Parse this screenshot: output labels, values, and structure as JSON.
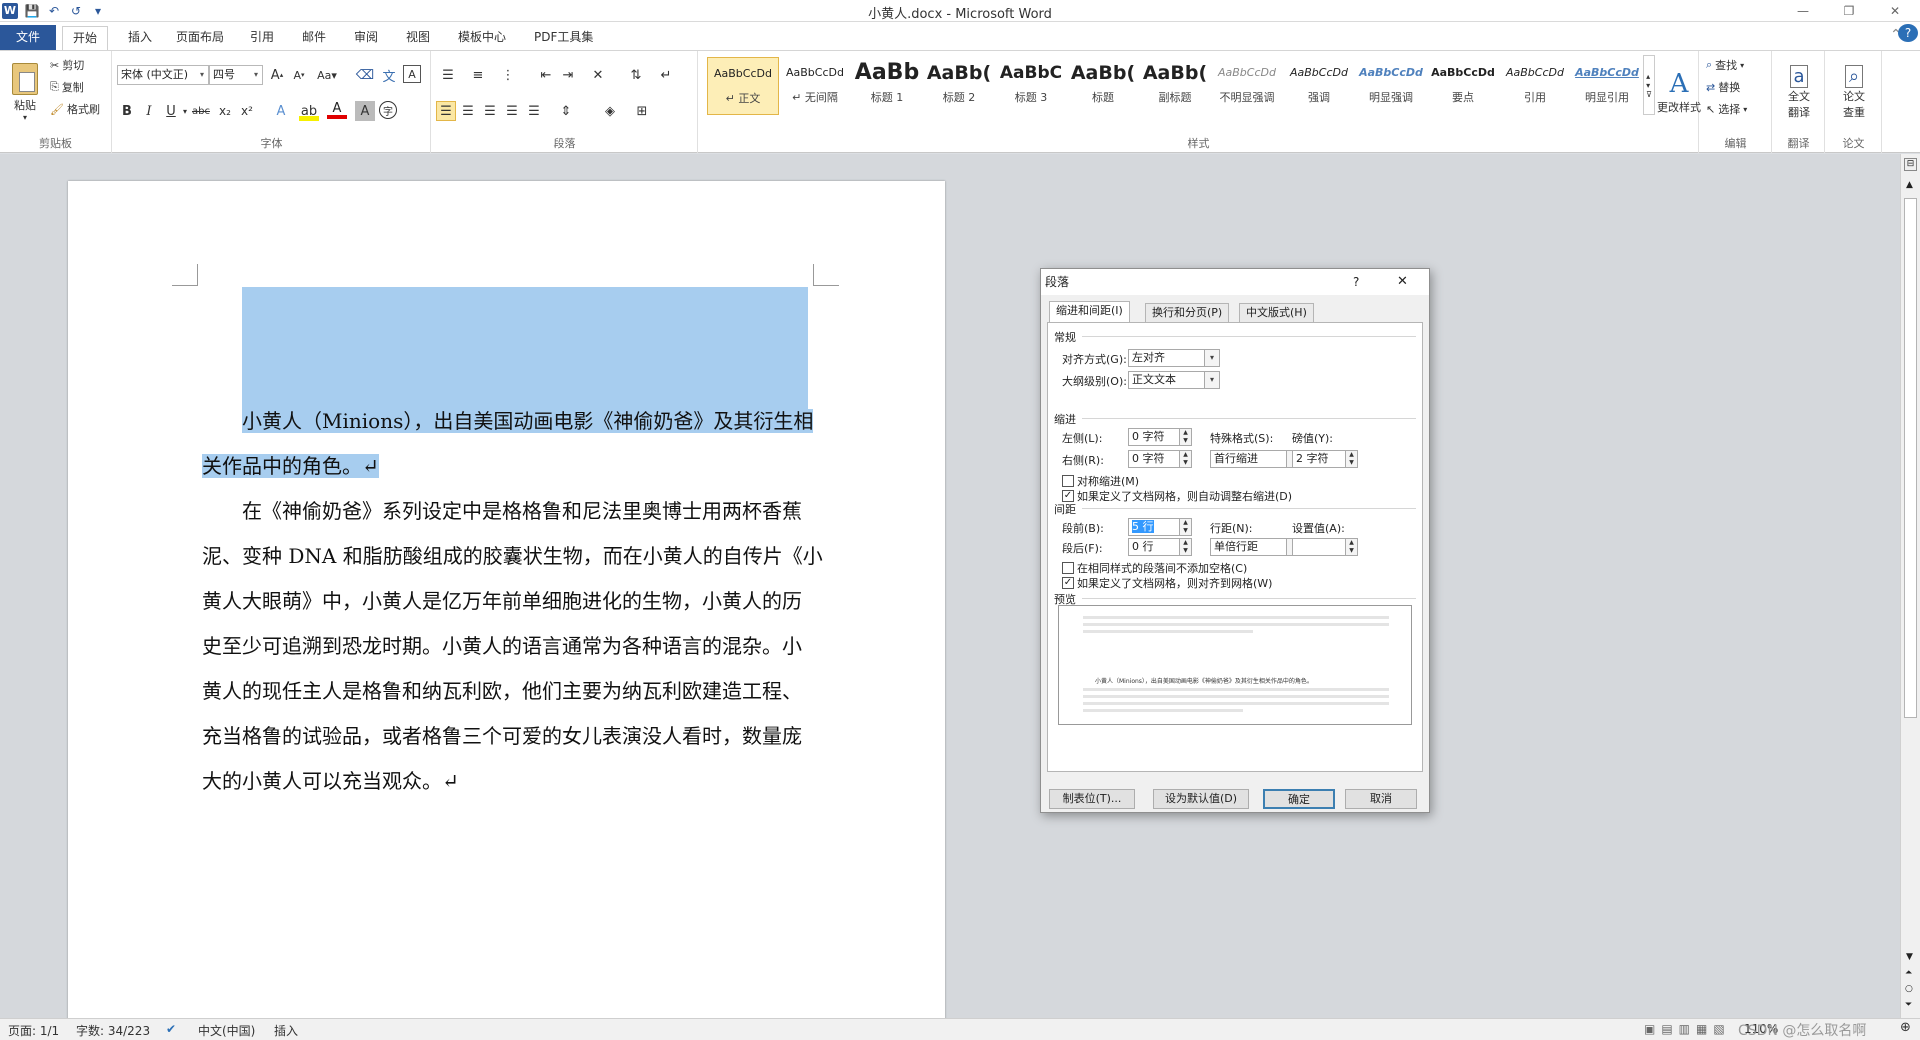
{
  "window": {
    "title": "小黄人.docx - Microsoft Word",
    "minimize": "—",
    "restore": "❐",
    "close": "✕"
  },
  "qat": {
    "logo": "W",
    "save": "💾",
    "undo": "↶",
    "redo": "↺",
    "customize": "▾"
  },
  "tabs": {
    "file": "文件",
    "home": "开始",
    "insert": "插入",
    "layout": "页面布局",
    "references": "引用",
    "mailings": "邮件",
    "review": "审阅",
    "view": "视图",
    "template": "模板中心",
    "pdf": "PDF工具集"
  },
  "ribbon": {
    "clipboard": {
      "label": "剪贴板",
      "paste": "粘贴",
      "cut": "剪切",
      "copy": "复制",
      "format_painter": "格式刷"
    },
    "font": {
      "label": "字体",
      "font_name": "宋体 (中文正)",
      "font_size": "四号"
    },
    "paragraph": {
      "label": "段落"
    },
    "styles": {
      "label": "样式",
      "change_styles": "更改样式",
      "items": [
        {
          "preview": "AaBbCcDd",
          "name": "↵ 正文"
        },
        {
          "preview": "AaBbCcDd",
          "name": "↵ 无间隔"
        },
        {
          "preview": "AaBb",
          "name": "标题 1"
        },
        {
          "preview": "AaBb(",
          "name": "标题 2"
        },
        {
          "preview": "AaBbC",
          "name": "标题 3"
        },
        {
          "preview": "AaBb(",
          "name": "标题"
        },
        {
          "preview": "AaBb(",
          "name": "副标题"
        },
        {
          "preview": "AaBbCcDd",
          "name": "不明显强调"
        },
        {
          "preview": "AaBbCcDd",
          "name": "强调"
        },
        {
          "preview": "AaBbCcDd",
          "name": "明显强调"
        },
        {
          "preview": "AaBbCcDd",
          "name": "要点"
        },
        {
          "preview": "AaBbCcDd",
          "name": "引用"
        },
        {
          "preview": "AaBbCcDd",
          "name": "明显引用"
        }
      ]
    },
    "editing": {
      "label": "编辑",
      "find": "查找",
      "replace": "替换",
      "select": "选择"
    },
    "translate": {
      "label": "翻译",
      "full": "全文",
      "full2": "翻译"
    },
    "paper": {
      "label": "论文",
      "check": "论文",
      "check2": "查重"
    }
  },
  "document": {
    "para1_line1": "小黄人（Minions），出自美国动画电影《神偷奶爸》及其衍生相",
    "para1_line2": "关作品中的角色。↵",
    "para2_lines": [
      "在《神偷奶爸》系列设定中是格格鲁和尼法里奥博士用两杯香蕉",
      "泥、变种 DNA 和脂肪酸组成的胶囊状生物，而在小黄人的自传片《小",
      "黄人大眼萌》中，小黄人是亿万年前单细胞进化的生物，小黄人的历",
      "史至少可追溯到恐龙时期。小黄人的语言通常为各种语言的混杂。小",
      "黄人的现任主人是格鲁和纳瓦利欧，他们主要为纳瓦利欧建造工程、",
      "充当格鲁的试验品，或者格鲁三个可爱的女儿表演没人看时，数量庞",
      "大的小黄人可以充当观众。↵"
    ]
  },
  "dialog": {
    "title": "段落",
    "help": "?",
    "close": "✕",
    "tabs": [
      "缩进和间距(I)",
      "换行和分页(P)",
      "中文版式(H)"
    ],
    "general": {
      "heading": "常规",
      "alignment_label": "对齐方式(G):",
      "alignment_value": "左对齐",
      "outline_label": "大纲级别(O):",
      "outline_value": "正文文本"
    },
    "indent": {
      "heading": "缩进",
      "left_label": "左侧(L):",
      "left_value": "0 字符",
      "right_label": "右侧(R):",
      "right_value": "0 字符",
      "special_label": "特殊格式(S):",
      "special_value": "首行缩进",
      "by_label": "磅值(Y):",
      "by_value": "2 字符",
      "mirror": "对称缩进(M)",
      "auto_adjust": "如果定义了文档网格，则自动调整右缩进(D)"
    },
    "spacing": {
      "heading": "间距",
      "before_label": "段前(B):",
      "before_value": "5 行",
      "after_label": "段后(F):",
      "after_value": "0 行",
      "line_label": "行距(N):",
      "line_value": "单倍行距",
      "at_label": "设置值(A):",
      "at_value": "",
      "no_space": "在相同样式的段落间不添加空格(C)",
      "snap_grid": "如果定义了文档网格，则对齐到网格(W)"
    },
    "preview": {
      "heading": "预览",
      "sample": "小黄人（Minions），出自美国动画电影《神偷奶爸》及其衍生相关作品中的角色。"
    },
    "buttons": {
      "tabs": "制表位(T)...",
      "default": "设为默认值(D)",
      "ok": "确定",
      "cancel": "取消"
    }
  },
  "status": {
    "page": "页面: 1/1",
    "words": "字数: 34/223",
    "lang": "中文(中国)",
    "mode": "插入",
    "zoom": "110%",
    "watermark": "CSDN @怎么取名啊"
  }
}
